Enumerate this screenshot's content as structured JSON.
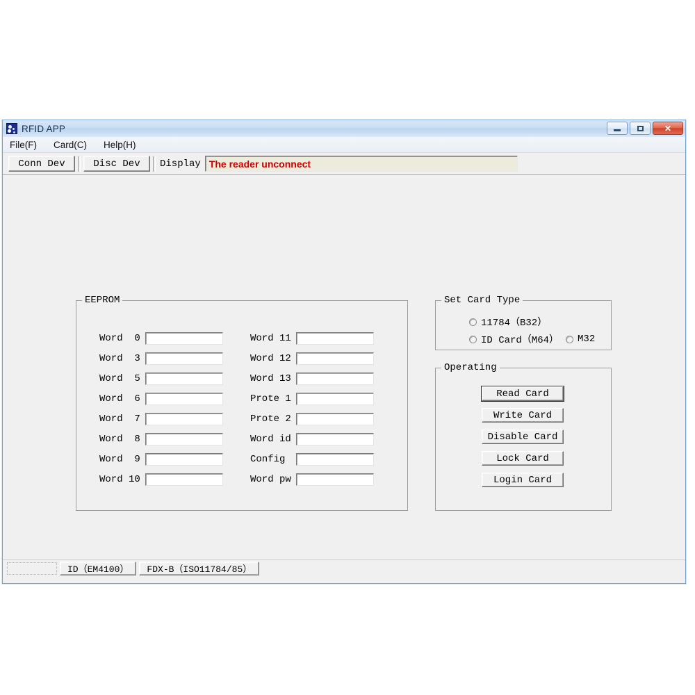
{
  "window": {
    "title": "RFID APP",
    "icon": "rfid-app-icon",
    "controls": {
      "minimize_label": "–",
      "maximize_label": "□",
      "close_label": "✕"
    }
  },
  "menu": {
    "items": [
      {
        "label": "File(F)",
        "name": "menu-file"
      },
      {
        "label": "Card(C)",
        "name": "menu-card"
      },
      {
        "label": "Help(H)",
        "name": "menu-help"
      }
    ]
  },
  "toolbar": {
    "conn_dev_label": "Conn Dev",
    "disc_dev_label": "Disc Dev",
    "display_label": "Display",
    "display_value": "The reader unconnect",
    "display_value_color": "#cc0000",
    "display_field_bg": "#edebdc"
  },
  "eeprom": {
    "title": "EEPROM",
    "left_fields": [
      {
        "label": "Word  0",
        "value": "",
        "name": "word-0"
      },
      {
        "label": "Word  3",
        "value": "",
        "name": "word-3"
      },
      {
        "label": "Word  5",
        "value": "",
        "name": "word-5"
      },
      {
        "label": "Word  6",
        "value": "",
        "name": "word-6"
      },
      {
        "label": "Word  7",
        "value": "",
        "name": "word-7"
      },
      {
        "label": "Word  8",
        "value": "",
        "name": "word-8"
      },
      {
        "label": "Word  9",
        "value": "",
        "name": "word-9"
      },
      {
        "label": "Word 10",
        "value": "",
        "name": "word-10"
      }
    ],
    "right_fields": [
      {
        "label": "Word 11",
        "value": "",
        "name": "word-11"
      },
      {
        "label": "Word 12",
        "value": "",
        "name": "word-12"
      },
      {
        "label": "Word 13",
        "value": "",
        "name": "word-13"
      },
      {
        "label": "Prote 1",
        "value": "",
        "name": "prote-1"
      },
      {
        "label": "Prote 2",
        "value": "",
        "name": "prote-2"
      },
      {
        "label": "Word id",
        "value": "",
        "name": "word-id"
      },
      {
        "label": "Config",
        "value": "",
        "name": "config"
      },
      {
        "label": "Word pw",
        "value": "",
        "name": "word-pw"
      }
    ]
  },
  "card_type": {
    "title": "Set Card Type",
    "options": [
      {
        "label": "11784（B32）",
        "checked": false,
        "name": "radio-11784-b32"
      },
      {
        "label": "ID Card（M64）",
        "checked": false,
        "name": "radio-id-card-m64"
      },
      {
        "label": "M32",
        "checked": false,
        "name": "radio-m32"
      }
    ]
  },
  "operating": {
    "title": "Operating",
    "buttons": [
      {
        "label": "Read Card",
        "name": "read-card-button",
        "focused": true
      },
      {
        "label": "Write Card",
        "name": "write-card-button",
        "focused": false
      },
      {
        "label": "Disable Card",
        "name": "disable-card-button",
        "focused": false
      },
      {
        "label": "Lock Card",
        "name": "lock-card-button",
        "focused": false
      },
      {
        "label": "Login Card",
        "name": "login-card-button",
        "focused": false
      }
    ]
  },
  "status_bar": {
    "panels": [
      {
        "label": "ID（EM4100）",
        "name": "status-panel-id-em4100"
      },
      {
        "label": "FDX-B（ISO11784/85）",
        "name": "status-panel-fdxb"
      }
    ]
  }
}
